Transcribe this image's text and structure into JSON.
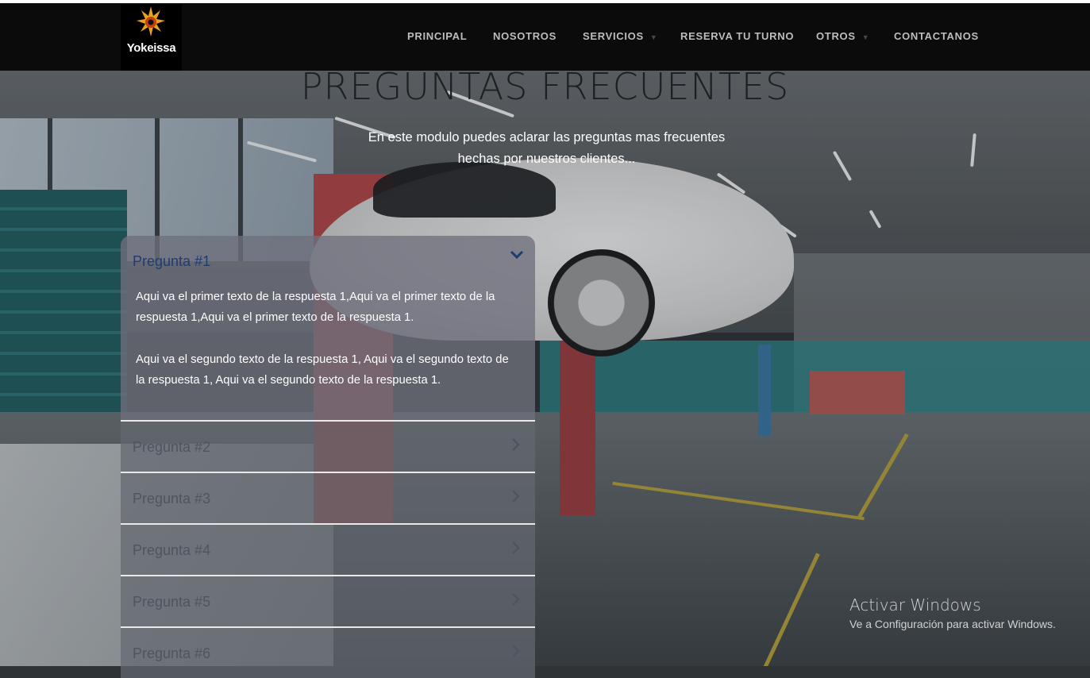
{
  "brand": {
    "logo_text": "Yokeissa"
  },
  "nav": {
    "items": [
      {
        "label": "PRINCIPAL",
        "has_dropdown": false
      },
      {
        "label": "NOSOTROS",
        "has_dropdown": false
      },
      {
        "label": "SERVICIOS",
        "has_dropdown": true
      },
      {
        "label": "RESERVA TU TURNO",
        "has_dropdown": false
      },
      {
        "label": "OTROS",
        "has_dropdown": true
      },
      {
        "label": "CONTACTANOS",
        "has_dropdown": false
      }
    ]
  },
  "faq_section": {
    "title": "PREGUNTAS FRECUENTES",
    "subtitle": "En este modulo puedes aclarar las preguntas mas frecuentes hechas por nuestros clientes...",
    "items": [
      {
        "question": "Pregunta #1",
        "expanded": true,
        "answer": [
          "Aqui va el primer texto de la respuesta 1,Aqui va el primer texto de la respuesta 1,Aqui va el primer texto de la respuesta 1.",
          "Aqui va el segundo texto de la respuesta 1, Aqui va el segundo texto de la respuesta 1, Aqui va el segundo texto de la respuesta 1."
        ]
      },
      {
        "question": "Pregunta #2",
        "expanded": false
      },
      {
        "question": "Pregunta #3",
        "expanded": false
      },
      {
        "question": "Pregunta #4",
        "expanded": false
      },
      {
        "question": "Pregunta #5",
        "expanded": false
      },
      {
        "question": "Pregunta #6",
        "expanded": false
      }
    ]
  },
  "windows_watermark": {
    "line1": "Activar Windows",
    "line2": "Ve a Configuración para activar Windows."
  },
  "colors": {
    "navbar_bg": "#0b0b0b",
    "nav_text": "#bdbdbd",
    "question_open_color": "#1f3b72",
    "accordion_panel": "#6e707c"
  },
  "icons": {
    "logo": "sun-flame-logo",
    "open_toggle": "chevron-down-icon",
    "closed_toggle": "chevron-right-icon",
    "nav_dropdown": "caret-down-icon"
  }
}
